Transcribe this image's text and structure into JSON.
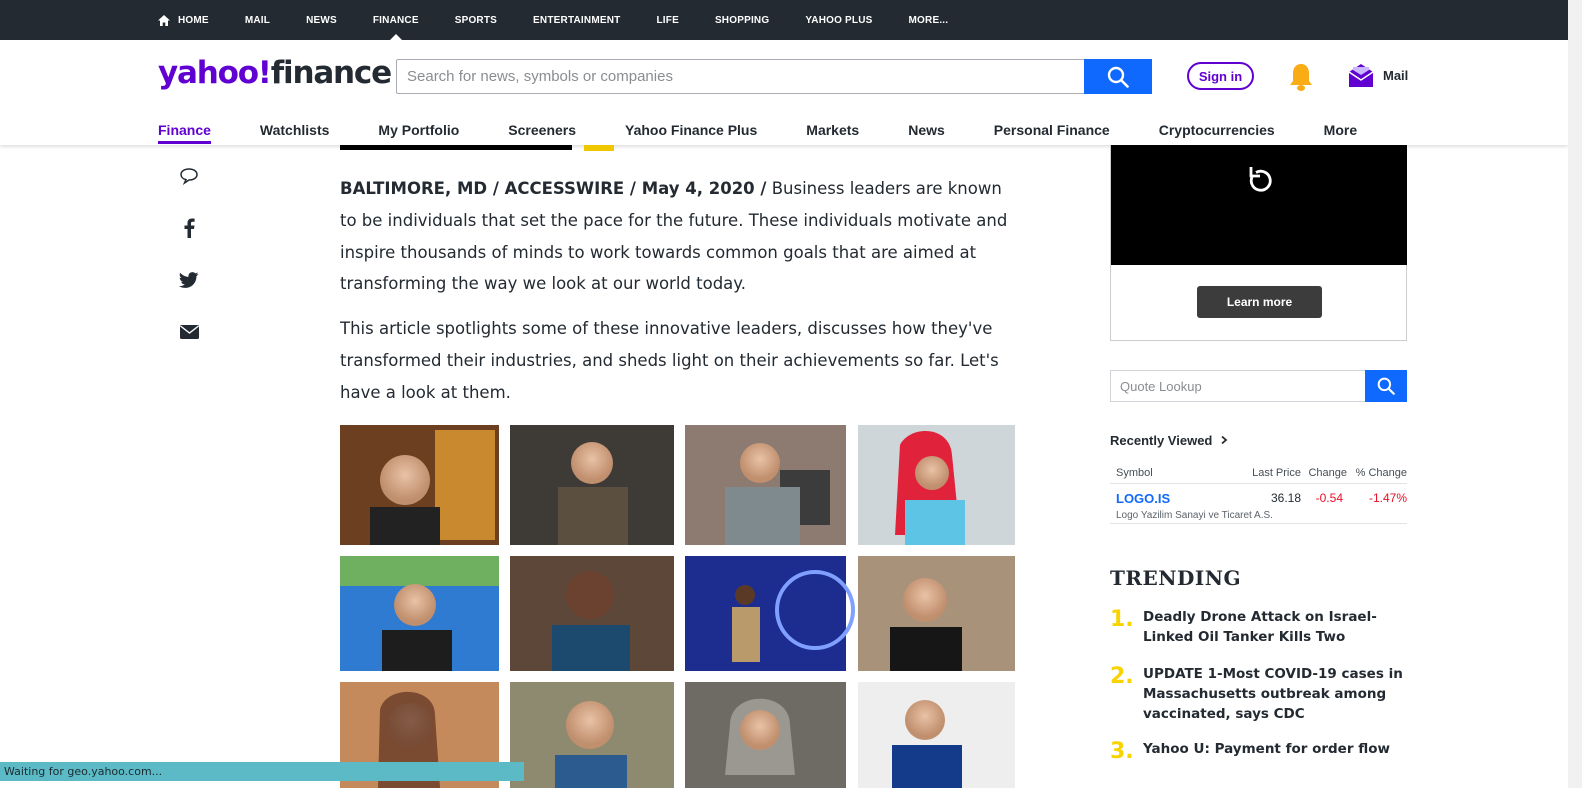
{
  "top_nav": {
    "items": [
      "HOME",
      "MAIL",
      "NEWS",
      "FINANCE",
      "SPORTS",
      "ENTERTAINMENT",
      "LIFE",
      "SHOPPING",
      "YAHOO PLUS",
      "MORE..."
    ],
    "active": "FINANCE"
  },
  "header": {
    "logo_yahoo": "yahoo!",
    "logo_finance": "finance",
    "search_placeholder": "Search for news, symbols or companies",
    "signin_label": "Sign in",
    "mail_label": "Mail"
  },
  "sub_nav": {
    "items": [
      "Finance",
      "Watchlists",
      "My Portfolio",
      "Screeners",
      "Yahoo Finance Plus",
      "Markets",
      "News",
      "Personal Finance",
      "Cryptocurrencies",
      "More"
    ],
    "active": "Finance"
  },
  "share_icons": [
    "comment-icon",
    "facebook-icon",
    "twitter-icon",
    "email-icon"
  ],
  "article": {
    "dateline": "BALTIMORE, MD / ACCESSWIRE / May 4, 2020 /",
    "para1": "Business leaders are known to be individuals that set the pace for the future. These individuals motivate and inspire thousands of minds to work towards common goals that are aimed at transforming the way we look at our world today.",
    "para2": "This article spotlights some of these innovative leaders, discusses how they've transformed their industries, and sheds light on their achievements so far. Let's have a look at them."
  },
  "ad": {
    "learn_more": "Learn more"
  },
  "quote_lookup": {
    "placeholder": "Quote Lookup"
  },
  "recently_viewed": {
    "title": "Recently Viewed",
    "columns": [
      "Symbol",
      "Last Price",
      "Change",
      "% Change"
    ],
    "rows": [
      {
        "symbol": "LOGO.IS",
        "last_price": "36.18",
        "change": "-0.54",
        "pct_change": "-1.47%",
        "name": "Logo Yazilim Sanayi ve Ticaret A.S."
      }
    ]
  },
  "trending": {
    "title": "TRENDING",
    "items": [
      {
        "num": "1.",
        "title": "Deadly Drone Attack on Israel-Linked Oil Tanker Kills Two"
      },
      {
        "num": "2.",
        "title": "UPDATE 1-Most COVID-19 cases in Massachusetts outbreak among vaccinated, says CDC"
      },
      {
        "num": "3.",
        "title": "Yahoo U: Payment for order flow"
      }
    ]
  },
  "status_bar": "Waiting for geo.yahoo.com...",
  "colors": {
    "brand": "#6001d2",
    "search_blue": "#0f69ff",
    "topbar": "#232a31",
    "negative": "#eb0f29",
    "trending_num": "#f9d300"
  }
}
